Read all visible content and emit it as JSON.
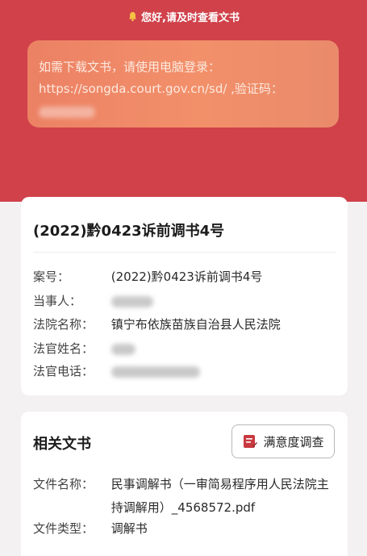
{
  "header": {
    "greeting": "您好,请及时查看文书",
    "notice_line1": "如需下载文书，请使用电脑登录：",
    "notice_line2": "https://songda.court.gov.cn/sd/ ,验证码："
  },
  "case": {
    "title": "(2022)黔0423诉前调书4号",
    "fields": [
      {
        "label": "案号：",
        "value": "(2022)黔0423诉前调书4号"
      },
      {
        "label": "当事人：",
        "value": ""
      },
      {
        "label": "法院名称：",
        "value": "镇宁布依族苗族自治县人民法院"
      },
      {
        "label": "法官姓名：",
        "value": ""
      },
      {
        "label": "法官电话：",
        "value": ""
      }
    ]
  },
  "docs": {
    "title": "相关文书",
    "survey_label": "满意度调查",
    "file_name_label": "文件名称：",
    "file_name_value": "民事调解书（一审简易程序用人民法院主持调解用）_4568572.pdf",
    "file_type_label": "文件类型：",
    "file_type_value": "调解书"
  },
  "colors": {
    "hero": "#d0414a",
    "notice": "#ef8866",
    "survey_icon": "#c8393f"
  }
}
